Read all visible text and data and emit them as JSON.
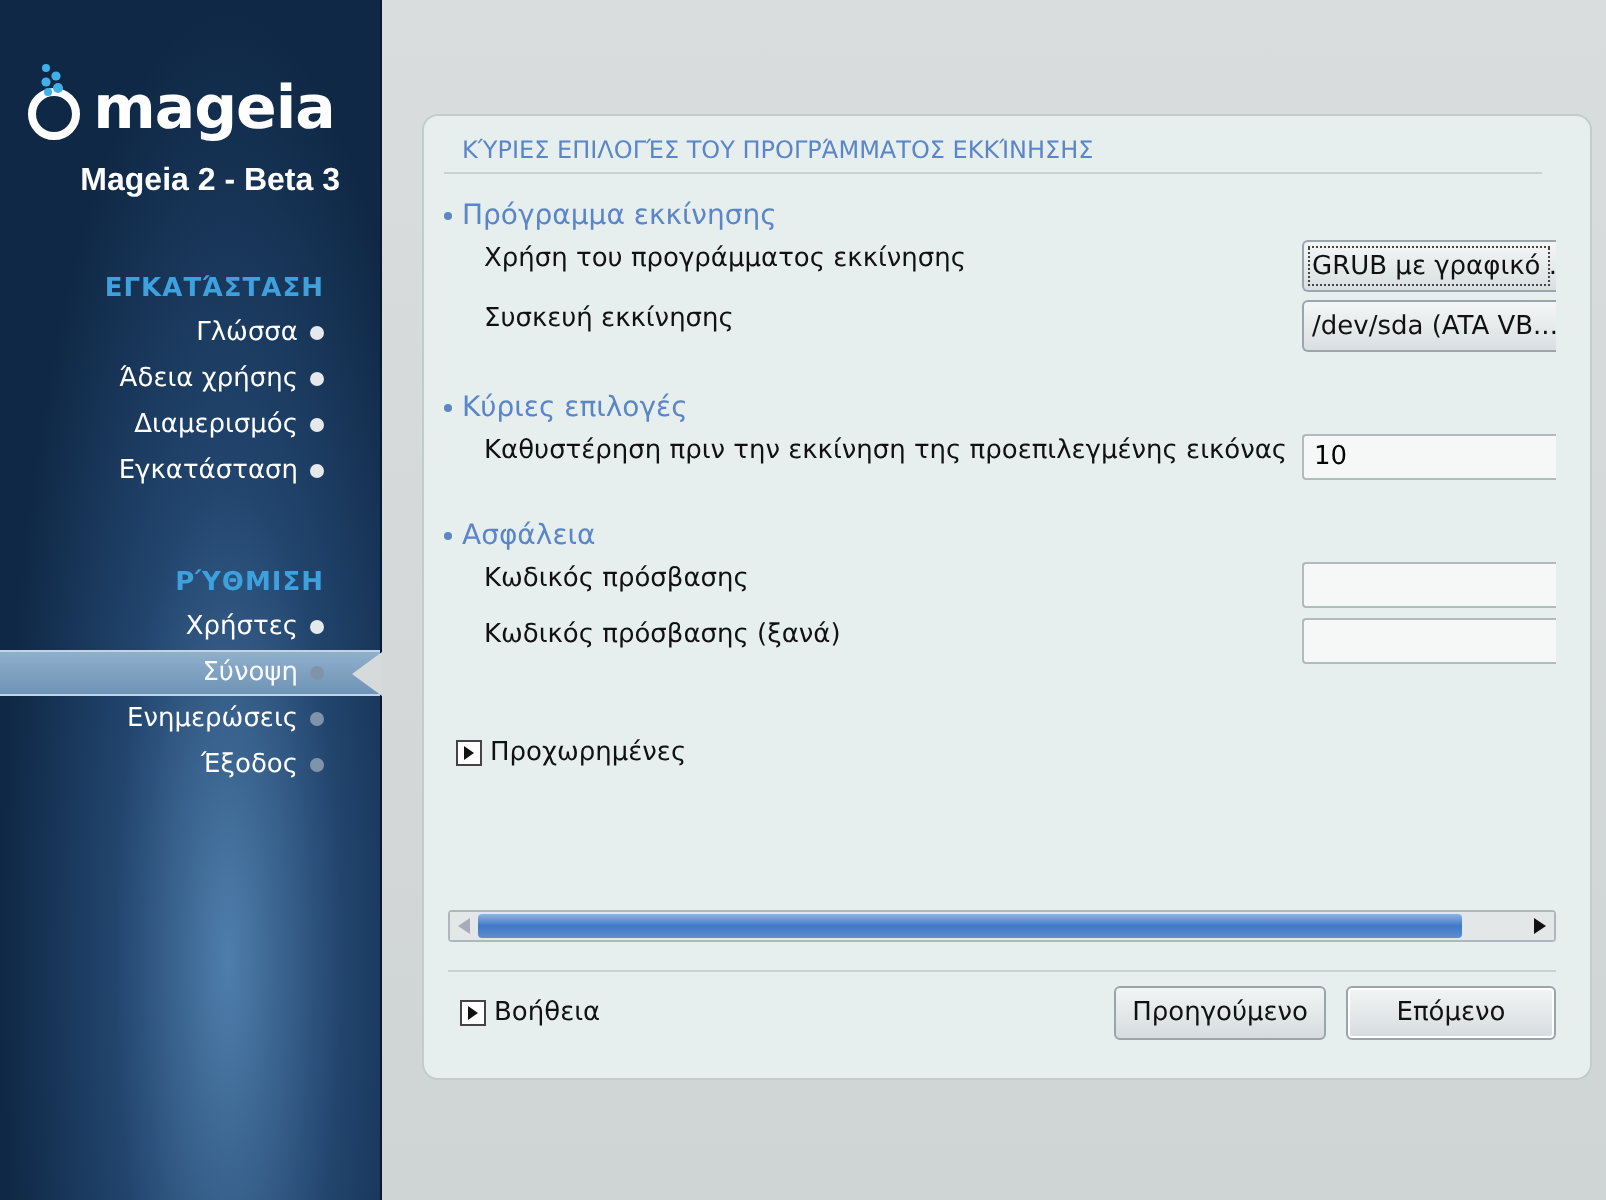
{
  "sidebar": {
    "logo_text": "mageia",
    "version": "Mageia 2 - Beta 3",
    "groups": [
      {
        "title": "ΕΓΚΑΤΆΣΤΑΣΗ",
        "items": [
          {
            "label": "Γλώσσα",
            "selected": false,
            "done": true
          },
          {
            "label": "Άδεια χρήσης",
            "selected": false,
            "done": true
          },
          {
            "label": "Διαμερισμός",
            "selected": false,
            "done": true
          },
          {
            "label": "Εγκατάσταση",
            "selected": false,
            "done": true
          }
        ]
      },
      {
        "title": "ΡΎΘΜΙΣΗ",
        "items": [
          {
            "label": "Χρήστες",
            "selected": false,
            "done": true
          },
          {
            "label": "Σύνοψη",
            "selected": true,
            "done": false
          },
          {
            "label": "Ενημερώσεις",
            "selected": false,
            "done": false
          },
          {
            "label": "Έξοδος",
            "selected": false,
            "done": false
          }
        ]
      }
    ]
  },
  "panel": {
    "title": "ΚΎΡΙΕΣ ΕΠΙΛΟΓΈΣ ΤΟΥ ΠΡΟΓΡΆΜΜΑΤΟΣ ΕΚΚΊΝΗΣΗΣ",
    "sections": [
      {
        "heading": "Πρόγραμμα εκκίνησης",
        "rows": [
          {
            "label": "Χρήση του προγράμματος εκκίνησης",
            "kind": "combo",
            "value": "GRUB με γραφικό ."
          },
          {
            "label": "Συσκευή εκκίνησης",
            "kind": "combo",
            "value": "/dev/sda (ATA VB..."
          }
        ]
      },
      {
        "heading": "Κύριες επιλογές",
        "rows": [
          {
            "label": "Καθυστέρηση πριν την εκκίνηση της προεπιλεγμένης εικόνας",
            "kind": "entry",
            "value": "10"
          }
        ]
      },
      {
        "heading": "Ασφάλεια",
        "rows": [
          {
            "label": "Κωδικός πρόσβασης",
            "kind": "entry",
            "value": ""
          },
          {
            "label": "Κωδικός πρόσβασης (ξανά)",
            "kind": "entry",
            "value": ""
          }
        ]
      }
    ],
    "advanced": {
      "label": "Προχωρημένες",
      "expanded": false
    },
    "help": {
      "label": "Βοήθεια",
      "expanded": false
    },
    "buttons": [
      {
        "label": "Προηγούμενο",
        "focused": false
      },
      {
        "label": "Επόμενο",
        "focused": true
      }
    ]
  }
}
